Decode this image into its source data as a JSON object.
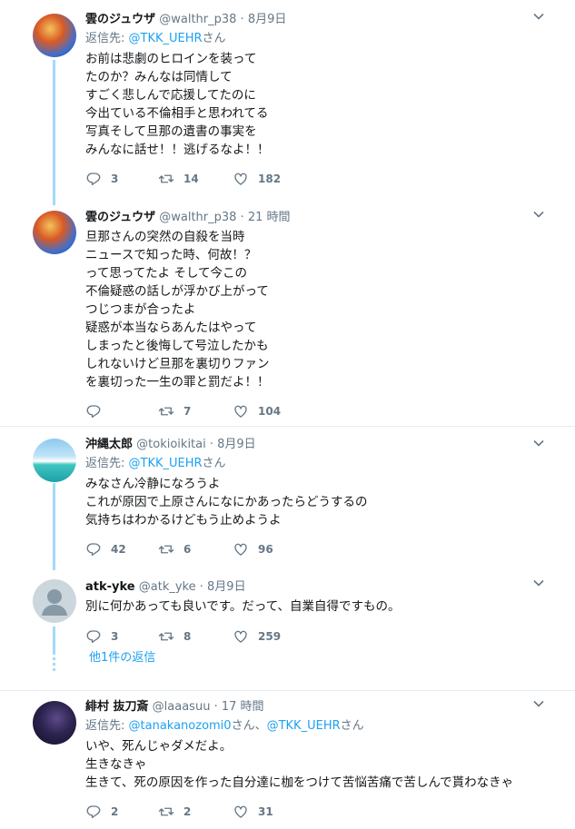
{
  "tweets": [
    {
      "name": "雲のジュウザ",
      "handle": "@walthr_p38",
      "time": "8月9日",
      "reply_prefix": "返信先: ",
      "reply_to": "@TKK_UEHR",
      "reply_suffix": "さん",
      "lines": [
        "お前は悲劇のヒロインを装って",
        "たのか？みんなは同情して",
        "すごく悲しんで応援してたのに",
        "今出ている不倫相手と思われてる",
        "写真そして旦那の遺書の事実を",
        "みんなに話せ！！逃げるなよ！！"
      ],
      "replies": "3",
      "retweets": "14",
      "likes": "182"
    },
    {
      "name": "雲のジュウザ",
      "handle": "@walthr_p38",
      "time": "21 時間",
      "lines": [
        "旦那さんの突然の自殺を当時",
        "ニュースで知った時、何故！？",
        "って思ってたよ そして今この",
        "不倫疑惑の話しが浮かび上がって",
        "つじつまが合ったよ",
        "疑惑が本当ならあんたはやって",
        "しまったと後悔して号泣したかも",
        "しれないけど旦那を裏切りファン",
        "を裏切った一生の罪と罰だよ！！"
      ],
      "replies": "",
      "retweets": "7",
      "likes": "104"
    },
    {
      "name": "沖縄太郎",
      "handle": "@tokioikitai",
      "time": "8月9日",
      "reply_prefix": "返信先: ",
      "reply_to": "@TKK_UEHR",
      "reply_suffix": "さん",
      "lines": [
        "みなさん冷静になろうよ",
        "これが原因で上原さんになにかあったらどうするの",
        "気持ちはわかるけどもう止めようよ"
      ],
      "replies": "42",
      "retweets": "6",
      "likes": "96"
    },
    {
      "name": "atk-yke",
      "handle": "@atk_yke",
      "time": "8月9日",
      "lines": [
        "別に何かあっても良いです。だって、自業自得ですもの。"
      ],
      "replies": "3",
      "retweets": "8",
      "likes": "259"
    },
    {
      "name": "緋村 抜刀斎",
      "handle": "@laaasuu",
      "time": "17 時間",
      "reply_prefix": "返信先: ",
      "reply_to": "@tanakanozomi0",
      "reply_mid": "さん、",
      "reply_to2": "@TKK_UEHR",
      "reply_suffix": "さん",
      "lines": [
        "いや、死んじゃダメだよ。",
        "生きなきゃ",
        "生きて、死の原因を作った自分達に枷をつけて苦悩苦痛で苦しんで貰わなきゃ"
      ],
      "replies": "2",
      "retweets": "2",
      "likes": "31"
    }
  ],
  "more_replies": "他1件の返信",
  "dot": " · ",
  "colors": {
    "accent": "#1da1f2",
    "muted": "#657786",
    "thread_line": "#a3d9fb",
    "divider": "#e6ecf0"
  },
  "icons": [
    "reply-icon",
    "retweet-icon",
    "like-icon",
    "chevron-down-icon"
  ]
}
